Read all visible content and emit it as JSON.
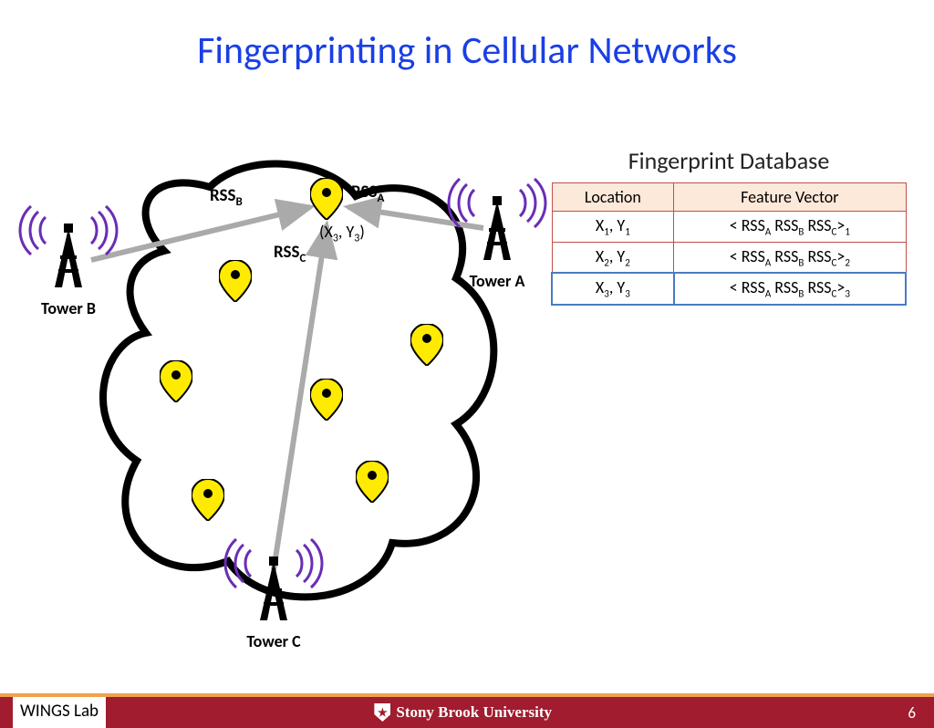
{
  "title": "Fingerprinting in Cellular Networks",
  "diagram": {
    "towers": {
      "A": "Tower A",
      "B": "Tower B",
      "C": "Tower C"
    },
    "rss": {
      "A_html": "RSS<sub>A</sub>",
      "B_html": "RSS<sub>B</sub>",
      "C_html": "RSS<sub>C</sub>"
    },
    "target_point_html": "(X<sub>3</sub>, Y<sub>3</sub>)"
  },
  "database": {
    "title": "Fingerprint Database",
    "headers": {
      "loc": "Location",
      "fv": "Feature Vector"
    },
    "rows": [
      {
        "loc_html": "X<sub>1</sub>, Y<sub>1</sub>",
        "fv_html": "&lt; RSS<sub>A</sub>  RSS<sub>B</sub>  RSS<sub>C</sub>&gt;<sub>1</sub>",
        "highlight": false
      },
      {
        "loc_html": "X<sub>2</sub>, Y<sub>2</sub>",
        "fv_html": "&lt; RSS<sub>A</sub>  RSS<sub>B</sub>  RSS<sub>C</sub>&gt;<sub>2</sub>",
        "highlight": false
      },
      {
        "loc_html": "X<sub>3</sub>, Y<sub>3</sub>",
        "fv_html": "&lt; RSS<sub>A</sub>  RSS<sub>B</sub>  RSS<sub>C</sub>&gt;<sub>3</sub>",
        "highlight": true
      }
    ]
  },
  "footer": {
    "lab": "WINGS Lab",
    "university": "Stony Brook University",
    "page": "6"
  }
}
